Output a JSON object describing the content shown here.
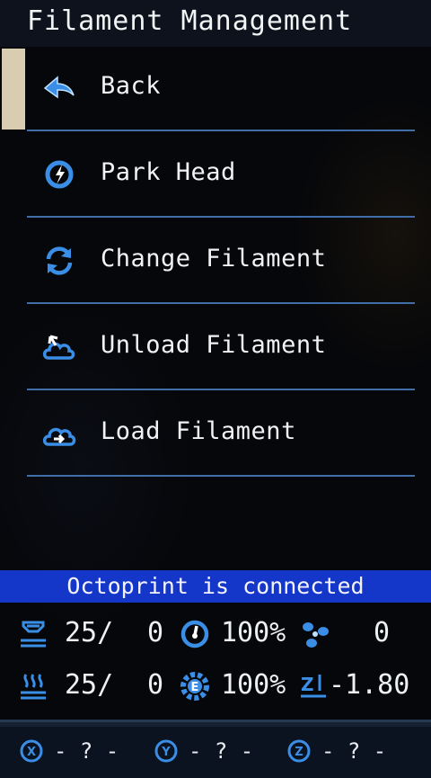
{
  "header": {
    "title": "Filament Management"
  },
  "menu": {
    "items": [
      {
        "label": "Back",
        "icon": "back-arrow-icon"
      },
      {
        "label": "Park Head",
        "icon": "park-head-icon"
      },
      {
        "label": "Change Filament",
        "icon": "refresh-icon"
      },
      {
        "label": "Unload Filament",
        "icon": "unload-filament-icon"
      },
      {
        "label": "Load Filament",
        "icon": "load-filament-icon"
      }
    ],
    "selected_index": 0
  },
  "status": {
    "text": "Octoprint is connected"
  },
  "readouts": {
    "bed_temp": {
      "current": "25/",
      "target": "0",
      "icon": "bed-temperature-icon"
    },
    "hotend_temp": {
      "current": "25/",
      "target": "0",
      "icon": "hotend-temperature-icon"
    },
    "speed": {
      "value": "100%",
      "icon": "speed-gauge-icon"
    },
    "flow": {
      "value": "100%",
      "icon": "extruder-flow-icon"
    },
    "fan": {
      "value": "0",
      "icon": "fan-icon"
    },
    "z_offset": {
      "value": "-1.80",
      "icon": "z-offset-icon"
    }
  },
  "axes": [
    {
      "letter": "X",
      "value": "- ? -",
      "icon": "x-axis-icon"
    },
    {
      "letter": "Y",
      "value": "- ? -",
      "icon": "y-axis-icon"
    },
    {
      "letter": "Z",
      "value": "- ? -",
      "icon": "z-axis-icon"
    }
  ],
  "colors": {
    "accent_blue": "#3a8ee6",
    "status_bar": "#1537c9",
    "selection": "#d8cdb1",
    "separator": "#3f6ea8"
  }
}
